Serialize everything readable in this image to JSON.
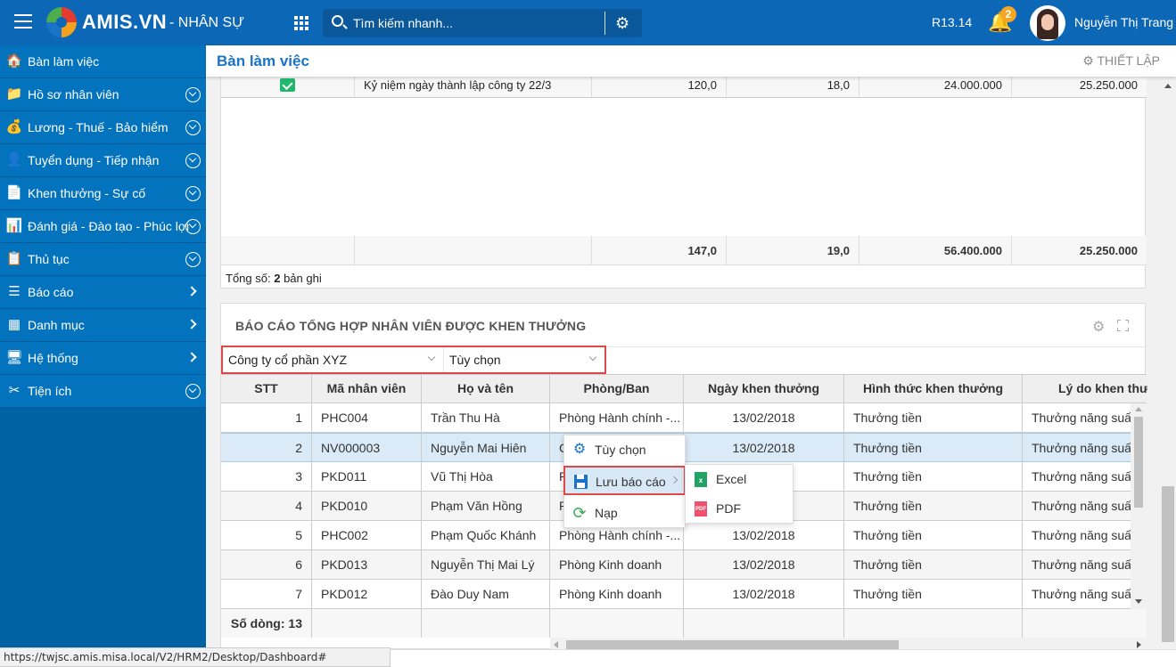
{
  "topbar": {
    "brand": "AMIS.VN",
    "module": "- NHÂN SỰ",
    "search_placeholder": "Tìm kiếm nhanh...",
    "version": "R13.14",
    "notification_count": "2",
    "user_name": "Nguyễn Thị Trang"
  },
  "sidebar": {
    "items": [
      {
        "label": "Bàn làm việc",
        "icon": "home-icon",
        "toggle": "none"
      },
      {
        "label": "Hồ sơ nhân viên",
        "icon": "profile-folder-icon",
        "toggle": "expand"
      },
      {
        "label": "Lương - Thuế - Bảo hiểm",
        "icon": "money-bag-icon",
        "toggle": "expand"
      },
      {
        "label": "Tuyển dụng - Tiếp nhận",
        "icon": "recruit-search-icon",
        "toggle": "expand"
      },
      {
        "label": "Khen thưởng - Sự cố",
        "icon": "award-document-icon",
        "toggle": "expand"
      },
      {
        "label": "Đánh giá - Đào tạo - Phúc lợi",
        "icon": "chart-board-icon",
        "toggle": "expand"
      },
      {
        "label": "Thủ tục",
        "icon": "clipboard-icon",
        "toggle": "expand"
      },
      {
        "label": "Báo cáo",
        "icon": "report-list-icon",
        "toggle": "arrow"
      },
      {
        "label": "Danh mục",
        "icon": "category-grid-icon",
        "toggle": "arrow"
      },
      {
        "label": "Hệ thống",
        "icon": "monitor-icon",
        "toggle": "arrow"
      },
      {
        "label": "Tiện ích",
        "icon": "tools-icon",
        "toggle": "expand"
      }
    ]
  },
  "page": {
    "title": "Bàn làm việc",
    "setup_label": "THIẾT LẬP"
  },
  "panel1": {
    "row": {
      "checked": true,
      "name": "Kỷ niệm ngày thành lập công ty 22/3",
      "v1": "120,0",
      "v2": "18,0",
      "v3": "24.000.000",
      "v4": "25.250.000"
    },
    "totals": {
      "v1": "147,0",
      "v2": "19,0",
      "v3": "56.400.000",
      "v4": "25.250.000"
    },
    "total_prefix": "Tổng số:",
    "total_count": "2",
    "total_suffix": "bản ghi"
  },
  "panel2": {
    "title": "BÁO CÁO TỔNG HỢP NHÂN VIÊN ĐƯỢC KHEN THƯỞNG",
    "filter_company": "Công ty cổ phần XYZ",
    "filter_period": "Tùy chọn",
    "columns": [
      "STT",
      "Mã nhân viên",
      "Họ và tên",
      "Phòng/Ban",
      "Ngày khen thưởng",
      "Hình thức khen thưởng",
      "Lý do khen thưởng"
    ],
    "rows": [
      {
        "stt": "1",
        "code": "PHC004",
        "name": "Trần Thu Hà",
        "dept": "Phòng Hành chính -...",
        "date": "13/02/2018",
        "type": "Thưởng tiền",
        "reason": "Thưởng năng suất"
      },
      {
        "stt": "2",
        "code": "NV000003",
        "name": "Nguyễn Mai Hiên",
        "dept": "C",
        "date": "13/02/2018",
        "type": "Thưởng tiền",
        "reason": "Thưởng năng suất"
      },
      {
        "stt": "3",
        "code": "PKD011",
        "name": "Vũ Thị Hòa",
        "dept": "P",
        "date": "",
        "type": "Thưởng tiền",
        "reason": "Thưởng năng suất"
      },
      {
        "stt": "4",
        "code": "PKD010",
        "name": "Phạm Văn Hồng",
        "dept": "P",
        "date": "",
        "type": "Thưởng tiền",
        "reason": "Thưởng năng suất"
      },
      {
        "stt": "5",
        "code": "PHC002",
        "name": "Phạm Quốc Khánh",
        "dept": "Phòng Hành chính -...",
        "date": "13/02/2018",
        "type": "Thưởng tiền",
        "reason": "Thưởng năng suất"
      },
      {
        "stt": "6",
        "code": "PKD013",
        "name": "Nguyễn Thị Mai Lý",
        "dept": "Phòng Kinh doanh",
        "date": "13/02/2018",
        "type": "Thưởng tiền",
        "reason": "Thưởng năng suất"
      },
      {
        "stt": "7",
        "code": "PKD012",
        "name": "Đào Duy Nam",
        "dept": "Phòng Kinh doanh",
        "date": "13/02/2018",
        "type": "Thưởng tiền",
        "reason": "Thưởng năng suất"
      }
    ],
    "footer_count": "Số dòng: 13"
  },
  "context_menu": {
    "items": [
      {
        "label": "Tùy chọn",
        "icon": "gear-icon"
      },
      {
        "label": "Lưu báo cáo",
        "icon": "save-icon",
        "has_submenu": true
      },
      {
        "label": "Nạp",
        "icon": "refresh-icon"
      }
    ],
    "submenu": [
      {
        "label": "Excel",
        "icon": "excel-file-icon",
        "glyph": "x",
        "color": "#21a366"
      },
      {
        "label": "PDF",
        "icon": "pdf-file-icon",
        "glyph": "PDF",
        "color": "#f0506e"
      }
    ]
  },
  "colors": {
    "brand_blue": "#0c67b6",
    "sidebar_blue": "#0473bd",
    "highlight_red": "#e04848",
    "selected_row": "#dbeaf7",
    "badge_orange": "#f5a623"
  },
  "status_url": "https://twjsc.amis.misa.local/V2/HRM2/Desktop/Dashboard#"
}
